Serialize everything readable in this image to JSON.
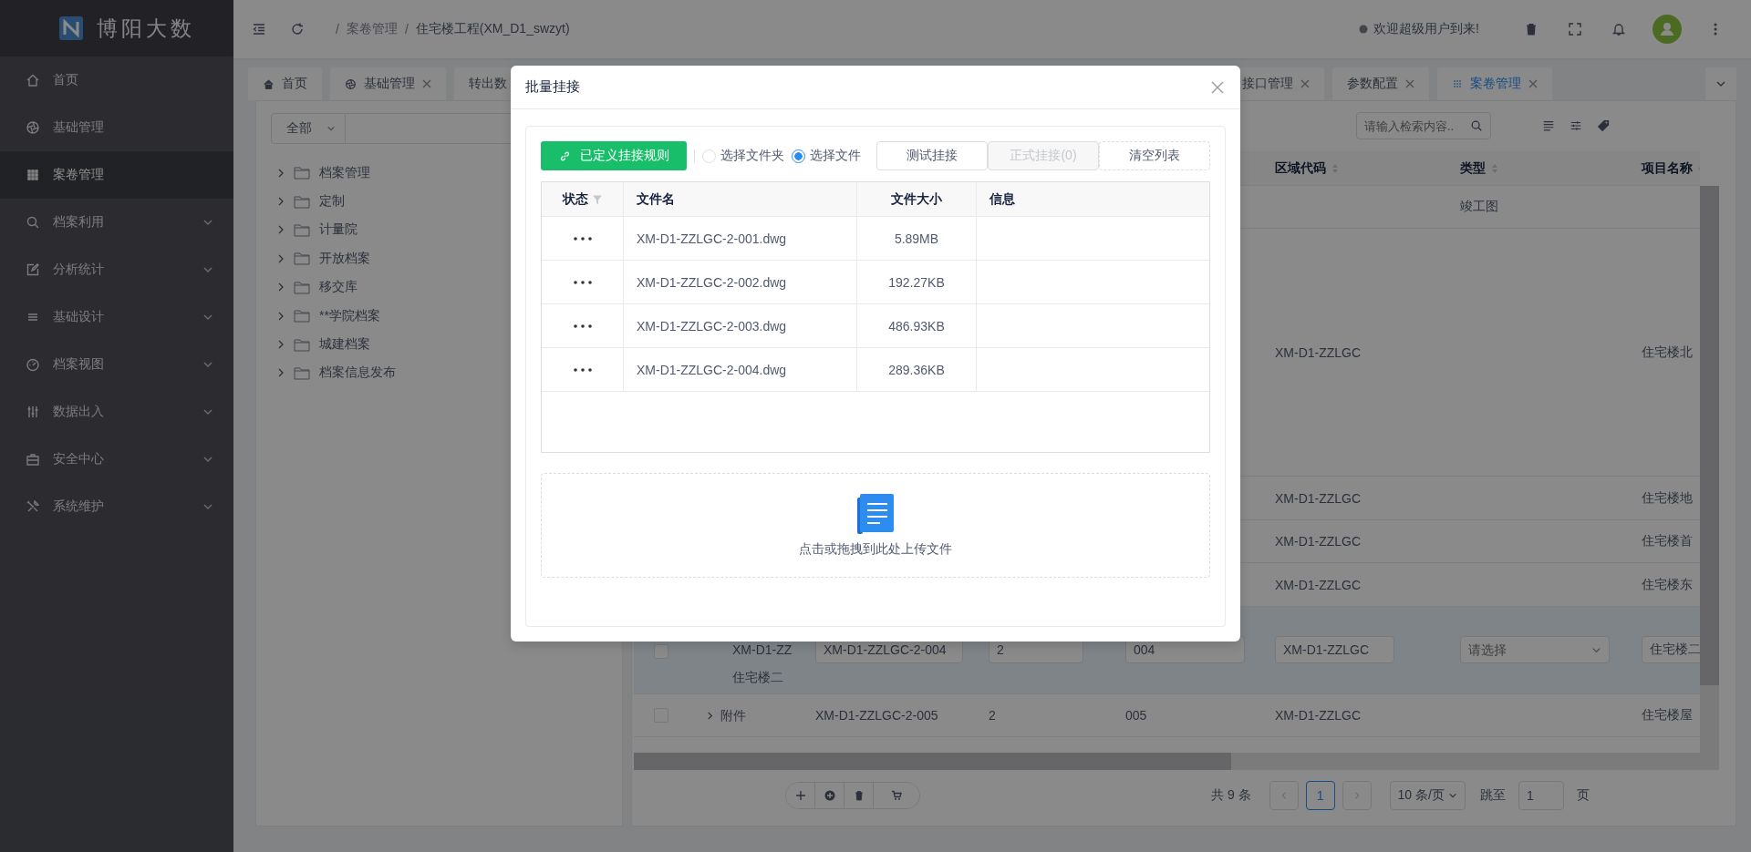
{
  "sidebar": {
    "logo": "博阳大数",
    "items": [
      {
        "label": "首页",
        "selected": false
      },
      {
        "label": "基础管理",
        "selected": false
      },
      {
        "label": "案卷管理",
        "selected": true
      },
      {
        "label": "档案利用",
        "selected": false,
        "expanded": false
      },
      {
        "label": "分析统计",
        "selected": false,
        "expanded": false
      },
      {
        "label": "基础设计",
        "selected": false,
        "expanded": false
      },
      {
        "label": "档案视图",
        "selected": false,
        "expanded": false
      },
      {
        "label": "数据出入",
        "selected": false,
        "expanded": false
      },
      {
        "label": "安全中心",
        "selected": false,
        "expanded": false
      },
      {
        "label": "系统维护",
        "selected": false,
        "expanded": false
      }
    ]
  },
  "header": {
    "separator": "/",
    "breadcrumb": [
      {
        "label": "案卷管理",
        "current": false
      },
      {
        "label": "住宅楼工程(XM_D1_swzyt)",
        "current": true
      }
    ],
    "welcome": "欢迎超级用户到来!"
  },
  "tabs": {
    "left": [
      {
        "label": "首页",
        "selected": false,
        "closable": false
      },
      {
        "label": "基础管理",
        "selected": false,
        "closable": true
      },
      {
        "label": "转出数",
        "selected": false,
        "closable": false
      }
    ],
    "right": [
      {
        "label": "接口管理",
        "selected": false,
        "closable": true
      },
      {
        "label": "参数配置",
        "selected": false,
        "closable": true
      },
      {
        "label": "案卷管理",
        "selected": true,
        "closable": true
      }
    ]
  },
  "tree": {
    "scope": "全部",
    "items": [
      {
        "label": "档案管理",
        "expanded": false
      },
      {
        "label": "定制",
        "expanded": false
      },
      {
        "label": "计量院",
        "expanded": false
      },
      {
        "label": "开放档案",
        "expanded": false
      },
      {
        "label": "移交库",
        "expanded": false
      },
      {
        "label": "**学院档案",
        "expanded": false
      },
      {
        "label": "城建档案",
        "expanded": false
      },
      {
        "label": "档案信息发布",
        "expanded": false
      }
    ]
  },
  "records": {
    "search": {
      "placeholder": "请输入检索内容.."
    },
    "columns": [
      {
        "label": "区域代码"
      },
      {
        "label": "类型"
      },
      {
        "label": "项目名称"
      }
    ],
    "rows": [
      {
        "editing": false,
        "type": "竣工图"
      },
      {
        "editing": false,
        "area_code": "XM-D1-ZZLGC",
        "project_name": "住宅楼北"
      },
      {
        "editing": false,
        "area_code": "XM-D1-ZZLGC",
        "project_name": "住宅楼地"
      },
      {
        "editing": false,
        "area_code": "XM-D1-ZZLGC",
        "project_name": "住宅楼首"
      },
      {
        "editing": false,
        "area_code": "XM-D1-ZZLGC",
        "project_name": "住宅楼东"
      },
      {
        "editing": true,
        "checked": false,
        "expandable": false,
        "column_2_lines": [
          "XM-D1-ZZ",
          "住宅楼二"
        ],
        "column_3": "XM-D1-ZZLGC-2-004",
        "column_4": "2",
        "column_5": "004",
        "area_code": "XM-D1-ZZLGC",
        "type_placeholder": "请选择",
        "project_name": "住宅楼二"
      },
      {
        "editing": false,
        "checked": false,
        "expandable": true,
        "column_2_lines": [
          "附件"
        ],
        "column_3": "XM-D1-ZZLGC-2-005",
        "column_4": "2",
        "column_5": "005",
        "area_code": "XM-D1-ZZLGC",
        "project_name": "住宅楼屋"
      }
    ],
    "pagination": {
      "total": "共 9 条",
      "pages": [
        {
          "label": "1",
          "selected": true
        }
      ],
      "page_size": "10 条/页",
      "jump_label": "跳至",
      "jump_value": "1",
      "page_suffix": "页"
    }
  },
  "dialog": {
    "title": "批量挂接",
    "rule_button": "已定义挂接规则",
    "sources": [
      {
        "label": "选择文件夹",
        "selected": false
      },
      {
        "label": "选择文件",
        "selected": true
      }
    ],
    "actions": [
      {
        "label": "测试挂接",
        "kind": "solid",
        "disabled": false
      },
      {
        "label": "正式挂接(0)",
        "kind": "solid",
        "disabled": true
      },
      {
        "label": "清空列表",
        "kind": "dashed",
        "disabled": false
      }
    ],
    "columns": [
      "状态",
      "文件名",
      "文件大小",
      "信息"
    ],
    "files": [
      {
        "name": "XM-D1-ZZLGC-2-001.dwg",
        "size": "5.89MB"
      },
      {
        "name": "XM-D1-ZZLGC-2-002.dwg",
        "size": "192.27KB"
      },
      {
        "name": "XM-D1-ZZLGC-2-003.dwg",
        "size": "486.93KB"
      },
      {
        "name": "XM-D1-ZZLGC-2-004.dwg",
        "size": "289.36KB"
      }
    ],
    "upload_hint": "点击或拖拽到此处上传文件"
  }
}
